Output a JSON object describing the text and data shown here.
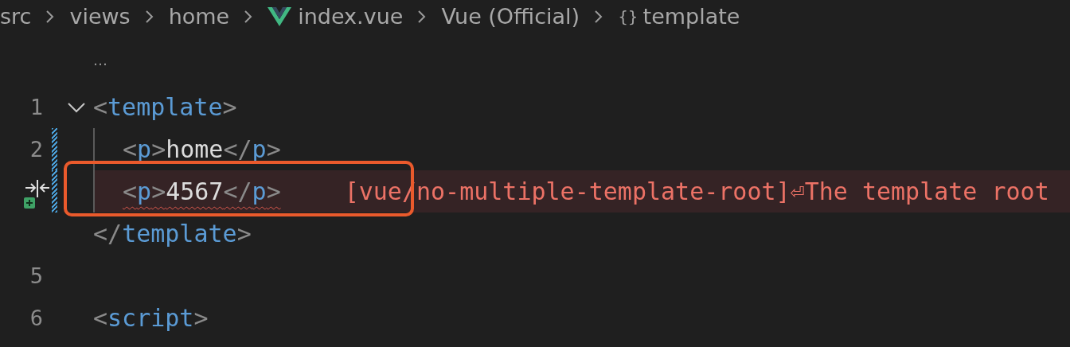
{
  "breadcrumb": [
    {
      "kind": "text",
      "text": "src"
    },
    {
      "kind": "text",
      "text": "views"
    },
    {
      "kind": "text",
      "text": "home"
    },
    {
      "kind": "vue",
      "text": "index.vue"
    },
    {
      "kind": "text",
      "text": "Vue (Official)"
    },
    {
      "kind": "braces",
      "symbol": "{}",
      "text": "template"
    }
  ],
  "folded_marker": "…",
  "lines": [
    {
      "number": "1",
      "foldable": true,
      "modified": false,
      "indented": false,
      "error": false,
      "gutter_icon": false,
      "tokens": [
        {
          "kind": "punct",
          "text": "<"
        },
        {
          "kind": "tag",
          "text": "template"
        },
        {
          "kind": "punct",
          "text": ">"
        }
      ]
    },
    {
      "number": "2",
      "foldable": false,
      "modified": true,
      "indented": true,
      "error": false,
      "gutter_icon": false,
      "tokens": [
        {
          "kind": "punct",
          "text": "<"
        },
        {
          "kind": "tag",
          "text": "p"
        },
        {
          "kind": "punct",
          "text": ">"
        },
        {
          "kind": "text",
          "text": "home"
        },
        {
          "kind": "punct",
          "text": "</"
        },
        {
          "kind": "tag",
          "text": "p"
        },
        {
          "kind": "punct",
          "text": ">"
        }
      ]
    },
    {
      "foldable": false,
      "modified": true,
      "indented": true,
      "error": true,
      "gutter_icon": true,
      "tokens": [
        {
          "kind": "punct",
          "text": "<"
        },
        {
          "kind": "tag",
          "text": "p"
        },
        {
          "kind": "punct",
          "text": ">"
        },
        {
          "kind": "text",
          "text": "4567"
        },
        {
          "kind": "punct",
          "text": "</"
        },
        {
          "kind": "tag",
          "text": "p"
        },
        {
          "kind": "punct",
          "text": ">"
        }
      ],
      "diagnostic": "[vue/no-multiple-template-root]⏎The template root"
    },
    {
      "foldable": false,
      "modified": false,
      "indented": false,
      "error": false,
      "gutter_icon": false,
      "tokens": [
        {
          "kind": "punct",
          "text": "</"
        },
        {
          "kind": "tag",
          "text": "template"
        },
        {
          "kind": "punct",
          "text": ">"
        }
      ]
    },
    {
      "number": "5",
      "foldable": false,
      "modified": false,
      "indented": false,
      "error": false,
      "gutter_icon": false
    },
    {
      "number": "6",
      "foldable": false,
      "modified": false,
      "indented": false,
      "error": false,
      "gutter_icon": false,
      "tokens": [
        {
          "kind": "punct",
          "text": "<"
        },
        {
          "kind": "tag",
          "text": "script"
        },
        {
          "kind": "punct",
          "text": ">"
        }
      ]
    }
  ]
}
